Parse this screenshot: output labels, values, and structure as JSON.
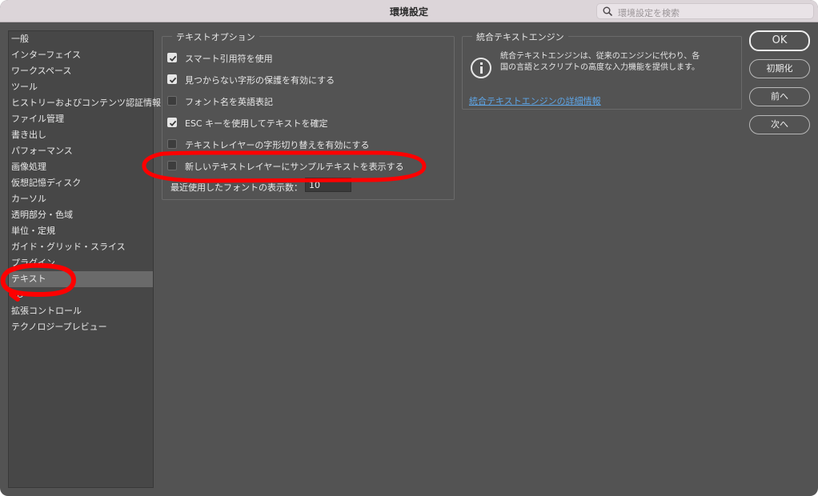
{
  "window": {
    "title": "環境設定"
  },
  "search": {
    "placeholder": "環境設定を検索"
  },
  "sidebar": {
    "items": [
      {
        "label": "一般"
      },
      {
        "label": "インターフェイス"
      },
      {
        "label": "ワークスペース"
      },
      {
        "label": "ツール"
      },
      {
        "label": "ヒストリーおよびコンテンツ認証情報"
      },
      {
        "label": "ファイル管理"
      },
      {
        "label": "書き出し"
      },
      {
        "label": "パフォーマンス"
      },
      {
        "label": "画像処理"
      },
      {
        "label": "仮想記憶ディスク"
      },
      {
        "label": "カーソル"
      },
      {
        "label": "透明部分・色域"
      },
      {
        "label": "単位・定規"
      },
      {
        "label": "ガイド・グリッド・スライス"
      },
      {
        "label": "プラグイン"
      },
      {
        "label": "テキスト",
        "selected": true
      },
      {
        "label": "3D"
      },
      {
        "label": "拡張コントロール"
      },
      {
        "label": "テクノロジープレビュー"
      }
    ]
  },
  "text_options": {
    "legend": "テキストオプション",
    "options": [
      {
        "label": "スマート引用符を使用",
        "checked": true
      },
      {
        "label": "見つからない字形の保護を有効にする",
        "checked": true
      },
      {
        "label": "フォント名を英語表記",
        "checked": false
      },
      {
        "label": "ESC キーを使用してテキストを確定",
        "checked": true
      },
      {
        "label": "テキストレイヤーの字形切り替えを有効にする",
        "checked": false
      },
      {
        "label": "新しいテキストレイヤーにサンプルテキストを表示する",
        "checked": false
      }
    ],
    "recent_fonts_label": "最近使用したフォントの表示数：",
    "recent_fonts_value": "10"
  },
  "engine": {
    "legend": "統合テキストエンジン",
    "description": "統合テキストエンジンは、従来のエンジンに代わり、各国の言語とスクリプトの高度な入力機能を提供します。",
    "link": "統合テキストエンジンの詳細情報"
  },
  "buttons": {
    "ok": "OK",
    "reset": "初期化",
    "prev": "前へ",
    "next": "次へ"
  },
  "colors": {
    "panel_bg": "#535353",
    "sidebar_bg": "#474747",
    "selected_bg": "#6a6a6a",
    "link": "#5ea6e8",
    "annotation": "#ff0000"
  }
}
